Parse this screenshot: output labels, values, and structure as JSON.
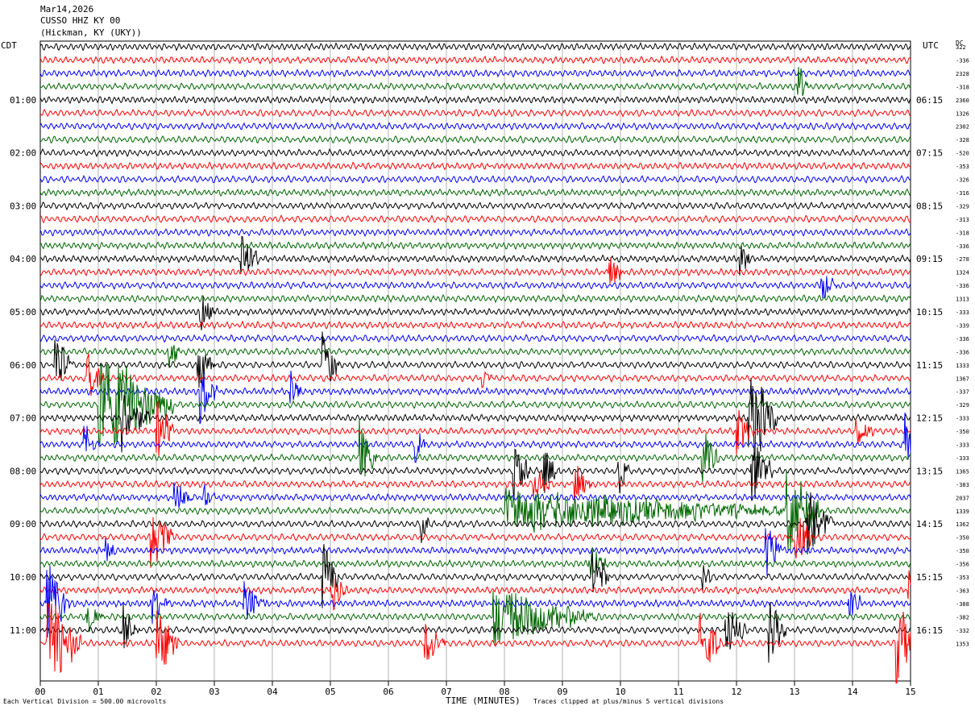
{
  "header": {
    "date": "Mar14,2026",
    "station": "CUSSO HHZ KY 00",
    "location": "(Hickman, KY (UKY))"
  },
  "left_timezone": "CDT",
  "right_timezone": "UTC",
  "dc_label": "DC",
  "footer": {
    "scale_note": "Each Vertical Division =  500.00 microvolts",
    "clip_note": "Traces clipped at plus/minus 5 vertical divisions"
  },
  "colors": {
    "trace": [
      "#000000",
      "#ff0000",
      "#0000ff",
      "#006600"
    ],
    "grid": "#808080"
  },
  "chart_data": {
    "type": "line",
    "title": "CUSSO HHZ KY 00",
    "xlabel": "TIME (MINUTES)",
    "x_ticks": [
      "00",
      "01",
      "02",
      "03",
      "04",
      "05",
      "06",
      "07",
      "08",
      "09",
      "10",
      "11",
      "12",
      "13",
      "14",
      "15"
    ],
    "xlim": [
      0,
      15
    ],
    "left_time_labels": [
      "01:00",
      "02:00",
      "03:00",
      "04:00",
      "05:00",
      "06:00",
      "07:00",
      "08:00",
      "09:00",
      "10:00",
      "11:00"
    ],
    "right_time_labels": [
      "06:15",
      "07:15",
      "08:15",
      "09:15",
      "10:15",
      "11:15",
      "12:15",
      "13:15",
      "14:15",
      "15:15",
      "16:15"
    ],
    "dc_offsets": [
      "322",
      "-336",
      "2328",
      "-318",
      "2360",
      "1326",
      "2302",
      "-328",
      "-520",
      "-353",
      "-326",
      "-316",
      "-329",
      "-313",
      "-318",
      "-336",
      "-278",
      "1324",
      "-336",
      "1313",
      "-333",
      "-339",
      "-336",
      "-336",
      "1333",
      "1367",
      "-337",
      "-329",
      "-333",
      "-350",
      "-333",
      "-333",
      "1365",
      "-383",
      "2037",
      "1339",
      "1362",
      "-350",
      "-350",
      "-356",
      "-353",
      "-363",
      "-388",
      "-382",
      "-332",
      "1353"
    ],
    "num_traces": 46,
    "trace_color_cycle": [
      "black",
      "red",
      "blue",
      "green"
    ],
    "events": [
      {
        "trace": 3,
        "minute": 13.05,
        "amp": 2.5,
        "dur": 0.18
      },
      {
        "trace": 16,
        "minute": 3.45,
        "amp": 2.8,
        "dur": 0.3
      },
      {
        "trace": 16,
        "minute": 12.05,
        "amp": 1.5,
        "dur": 0.2
      },
      {
        "trace": 17,
        "minute": 9.8,
        "amp": 1.5,
        "dur": 0.25
      },
      {
        "trace": 18,
        "minute": 13.45,
        "amp": 1.4,
        "dur": 0.3
      },
      {
        "trace": 20,
        "minute": 2.75,
        "amp": 1.8,
        "dur": 0.25
      },
      {
        "trace": 23,
        "minute": 2.2,
        "amp": 2.0,
        "dur": 0.2
      },
      {
        "trace": 24,
        "minute": 0.25,
        "amp": 3.0,
        "dur": 0.3
      },
      {
        "trace": 24,
        "minute": 2.7,
        "amp": 3.0,
        "dur": 0.3
      },
      {
        "trace": 24,
        "minute": 4.85,
        "amp": 3.0,
        "dur": 0.3
      },
      {
        "trace": 25,
        "minute": 0.8,
        "amp": 2.5,
        "dur": 0.3
      },
      {
        "trace": 25,
        "minute": 7.6,
        "amp": 1.3,
        "dur": 0.2
      },
      {
        "trace": 26,
        "minute": 2.75,
        "amp": 2.5,
        "dur": 0.3
      },
      {
        "trace": 26,
        "minute": 4.3,
        "amp": 1.6,
        "dur": 0.2
      },
      {
        "trace": 27,
        "minute": 1.0,
        "amp": 5.0,
        "dur": 1.3
      },
      {
        "trace": 28,
        "minute": 12.2,
        "amp": 5.0,
        "dur": 0.5
      },
      {
        "trace": 28,
        "minute": 1.4,
        "amp": 2.5,
        "dur": 0.5
      },
      {
        "trace": 29,
        "minute": 2.0,
        "amp": 3.0,
        "dur": 0.3
      },
      {
        "trace": 29,
        "minute": 12.0,
        "amp": 2.0,
        "dur": 0.3
      },
      {
        "trace": 29,
        "minute": 14.05,
        "amp": 1.5,
        "dur": 0.3
      },
      {
        "trace": 30,
        "minute": 0.75,
        "amp": 2.0,
        "dur": 0.2
      },
      {
        "trace": 30,
        "minute": 6.45,
        "amp": 2.0,
        "dur": 0.2
      },
      {
        "trace": 30,
        "minute": 14.9,
        "amp": 2.5,
        "dur": 0.2
      },
      {
        "trace": 31,
        "minute": 5.5,
        "amp": 3.0,
        "dur": 0.3
      },
      {
        "trace": 31,
        "minute": 11.4,
        "amp": 2.5,
        "dur": 0.3
      },
      {
        "trace": 32,
        "minute": 8.15,
        "amp": 3.0,
        "dur": 0.3
      },
      {
        "trace": 32,
        "minute": 8.65,
        "amp": 2.0,
        "dur": 0.3
      },
      {
        "trace": 32,
        "minute": 9.95,
        "amp": 2.5,
        "dur": 0.2
      },
      {
        "trace": 32,
        "minute": 12.25,
        "amp": 3.0,
        "dur": 0.4
      },
      {
        "trace": 33,
        "minute": 8.5,
        "amp": 1.8,
        "dur": 0.3
      },
      {
        "trace": 33,
        "minute": 9.2,
        "amp": 1.8,
        "dur": 0.3
      },
      {
        "trace": 34,
        "minute": 2.3,
        "amp": 1.8,
        "dur": 0.3
      },
      {
        "trace": 34,
        "minute": 2.8,
        "amp": 1.4,
        "dur": 0.2
      },
      {
        "trace": 35,
        "minute": 8.0,
        "amp": 1.8,
        "dur": 5.2
      },
      {
        "trace": 35,
        "minute": 12.85,
        "amp": 4.5,
        "dur": 0.6
      },
      {
        "trace": 36,
        "minute": 6.55,
        "amp": 1.6,
        "dur": 0.2
      },
      {
        "trace": 36,
        "minute": 13.2,
        "amp": 3.0,
        "dur": 0.5
      },
      {
        "trace": 37,
        "minute": 1.9,
        "amp": 3.0,
        "dur": 0.4
      },
      {
        "trace": 37,
        "minute": 13.0,
        "amp": 3.0,
        "dur": 0.3
      },
      {
        "trace": 38,
        "minute": 1.1,
        "amp": 1.5,
        "dur": 0.2
      },
      {
        "trace": 38,
        "minute": 12.5,
        "amp": 2.5,
        "dur": 0.3
      },
      {
        "trace": 39,
        "minute": 9.45,
        "amp": 2.0,
        "dur": 0.3
      },
      {
        "trace": 40,
        "minute": 4.85,
        "amp": 3.5,
        "dur": 0.3
      },
      {
        "trace": 40,
        "minute": 9.5,
        "amp": 3.0,
        "dur": 0.3
      },
      {
        "trace": 40,
        "minute": 11.4,
        "amp": 1.5,
        "dur": 0.2
      },
      {
        "trace": 41,
        "minute": 5.0,
        "amp": 2.0,
        "dur": 0.3
      },
      {
        "trace": 41,
        "minute": 14.95,
        "amp": 4.0,
        "dur": 0.15
      },
      {
        "trace": 42,
        "minute": 0.1,
        "amp": 4.0,
        "dur": 0.4
      },
      {
        "trace": 42,
        "minute": 1.9,
        "amp": 2.0,
        "dur": 0.3
      },
      {
        "trace": 42,
        "minute": 3.5,
        "amp": 2.0,
        "dur": 0.4
      },
      {
        "trace": 42,
        "minute": 13.9,
        "amp": 1.6,
        "dur": 0.3
      },
      {
        "trace": 43,
        "minute": 7.8,
        "amp": 2.5,
        "dur": 1.8
      },
      {
        "trace": 43,
        "minute": 0.8,
        "amp": 2.0,
        "dur": 0.3
      },
      {
        "trace": 44,
        "minute": 1.4,
        "amp": 2.5,
        "dur": 0.3
      },
      {
        "trace": 44,
        "minute": 11.8,
        "amp": 2.5,
        "dur": 0.4
      },
      {
        "trace": 44,
        "minute": 12.55,
        "amp": 3.0,
        "dur": 0.3
      },
      {
        "trace": 45,
        "minute": 0.1,
        "amp": 5.0,
        "dur": 0.6
      },
      {
        "trace": 45,
        "minute": 2.0,
        "amp": 3.0,
        "dur": 0.4
      },
      {
        "trace": 45,
        "minute": 6.6,
        "amp": 2.0,
        "dur": 0.4
      },
      {
        "trace": 45,
        "minute": 11.35,
        "amp": 3.5,
        "dur": 0.4
      },
      {
        "trace": 45,
        "minute": 14.75,
        "amp": 5.0,
        "dur": 0.3
      },
      {
        "trace": 46,
        "minute": 0.1,
        "amp": 5.0,
        "dur": 0.8
      },
      {
        "trace": 46,
        "minute": 9.6,
        "amp": 2.5,
        "dur": 0.2
      },
      {
        "trace": 46,
        "minute": 13.85,
        "amp": 2.5,
        "dur": 0.2
      },
      {
        "trace": 47,
        "minute": 0.1,
        "amp": 4.0,
        "dur": 0.6
      },
      {
        "trace": 47,
        "minute": 2.3,
        "amp": 4.0,
        "dur": 2.2
      },
      {
        "trace": 47,
        "minute": 4.9,
        "amp": 3.0,
        "dur": 0.3
      },
      {
        "trace": 47,
        "minute": 12.95,
        "amp": 2.5,
        "dur": 0.3
      }
    ]
  }
}
